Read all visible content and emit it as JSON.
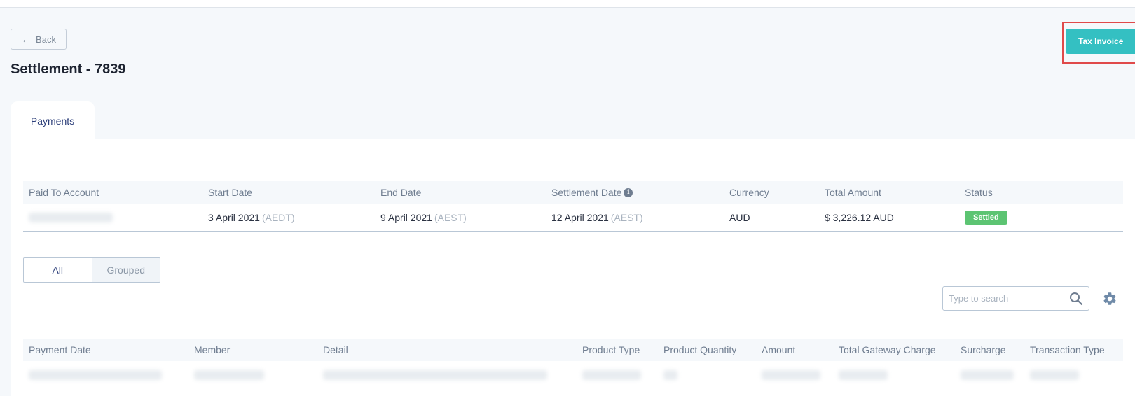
{
  "header": {
    "back_label": "Back",
    "title": "Settlement - 7839",
    "tax_invoice_label": "Tax Invoice"
  },
  "tabs": [
    {
      "label": "Payments",
      "active": true
    }
  ],
  "summary": {
    "columns": [
      "Paid To Account",
      "Start Date",
      "End Date",
      "Settlement Date",
      "Currency",
      "Total Amount",
      "Status"
    ],
    "row": {
      "start_date": "3 April 2021",
      "start_tz": "(AEDT)",
      "end_date": "9 April 2021",
      "end_tz": "(AEST)",
      "settlement_date": "12 April 2021",
      "settlement_tz": "(AEST)",
      "currency": "AUD",
      "total_amount": "$ 3,226.12 AUD",
      "status": "Settled"
    }
  },
  "view_toggle": {
    "all": "All",
    "grouped": "Grouped",
    "selected": "All"
  },
  "search": {
    "placeholder": "Type to search"
  },
  "payments_table": {
    "columns": [
      "Payment Date",
      "Member",
      "Detail",
      "Product Type",
      "Product Quantity",
      "Amount",
      "Total Gateway Charge",
      "Surcharge",
      "Transaction Type"
    ]
  },
  "colors": {
    "accent": "#34c0c2",
    "settled": "#5cc472",
    "highlight_border": "#e04a4a"
  },
  "icons": [
    "arrow-left-icon",
    "info-icon",
    "search-icon",
    "gear-icon"
  ]
}
